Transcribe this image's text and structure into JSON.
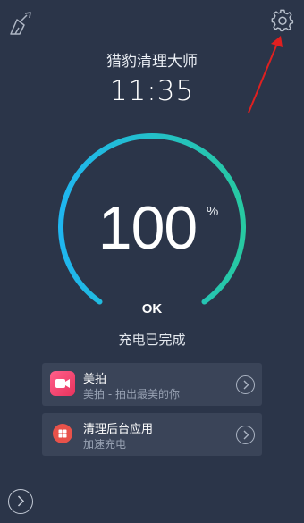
{
  "app": {
    "title": "猎豹清理大师",
    "time": "11:35",
    "charge_percent": "100",
    "percent_sign": "%",
    "charge_level": 1.0,
    "ok_label": "OK",
    "status_text": "充电已完成"
  },
  "icons": {
    "top_left": "broom-icon",
    "top_right": "gear-icon",
    "bottom_left": "chevron-right-circle-icon"
  },
  "cards": [
    {
      "title": "美拍",
      "subtitle": "美拍 - 拍出最美的你",
      "icon": "video-camera-icon",
      "icon_color": "#f0466a"
    },
    {
      "title": "清理后台应用",
      "subtitle": "加速充电",
      "icon": "apps-grid-icon",
      "icon_color": "#e8524a"
    }
  ],
  "colors": {
    "background": "#2b3549",
    "ring_start": "#1fb6f0",
    "ring_end": "#27c9a2",
    "annotation_arrow": "#e02020"
  }
}
